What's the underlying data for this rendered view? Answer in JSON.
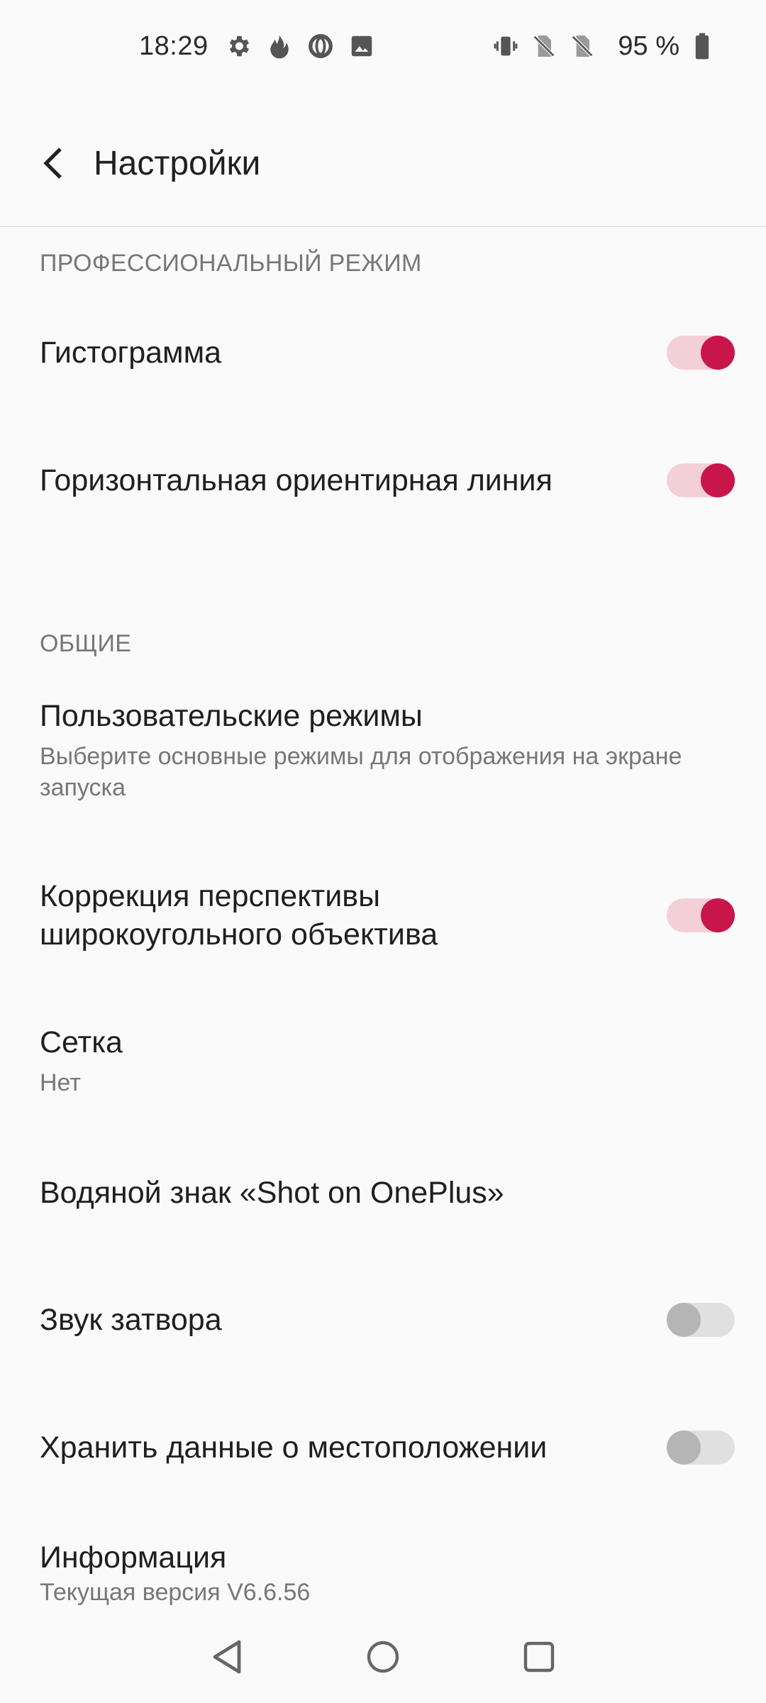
{
  "status_bar": {
    "time": "18:29",
    "battery_text": "95 %",
    "left_icons": [
      "gear-icon",
      "flame-icon",
      "opera-icon",
      "image-icon"
    ],
    "right_icons": [
      "vibrate-icon",
      "no-sim-icon",
      "no-sim-icon",
      "battery-icon"
    ]
  },
  "toolbar": {
    "title": "Настройки"
  },
  "sections": {
    "pro": {
      "header": "ПРОФЕССИОНАЛЬНЫЙ РЕЖИМ",
      "histogram": {
        "title": "Гистограмма",
        "enabled": true
      },
      "horizon_line": {
        "title": "Горизонтальная ориентирная линия",
        "enabled": true
      }
    },
    "general": {
      "header": "ОБЩИЕ",
      "custom_modes": {
        "title": "Пользовательские режимы",
        "subtitle": "Выберите основные режимы для отображения на экране запуска"
      },
      "perspective": {
        "title_line1": "Коррекция перспективы",
        "title_line2": "широкоугольного объектива",
        "enabled": true
      },
      "grid": {
        "title": "Сетка",
        "subtitle": "Нет"
      },
      "watermark": {
        "title": "Водяной знак «Shot on OnePlus»"
      },
      "shutter_sound": {
        "title": "Звук затвора",
        "enabled": false
      },
      "location": {
        "title": "Хранить данные о местоположении",
        "enabled": false
      },
      "info": {
        "title": "Информация",
        "subtitle": "Текущая версия V6.6.56"
      }
    }
  },
  "colors": {
    "accent": "#c8164a",
    "accent_track": "#f3d0d8",
    "background": "#fafafa"
  }
}
